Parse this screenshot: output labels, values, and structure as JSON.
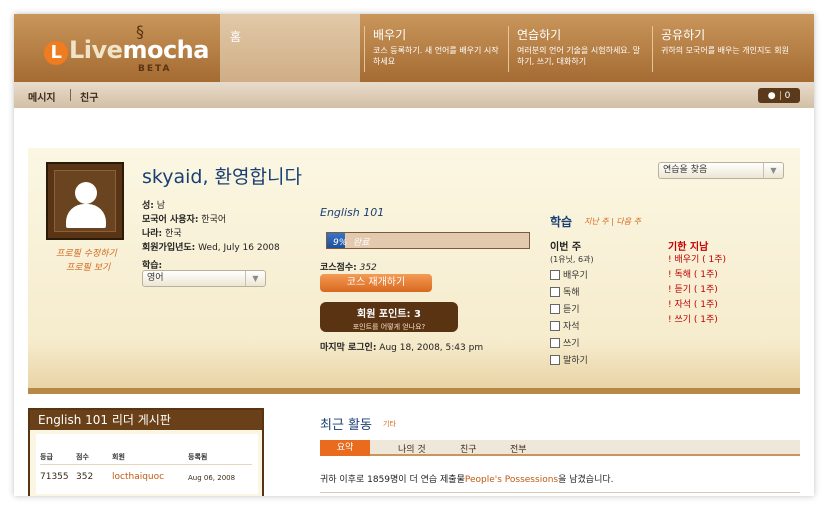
{
  "brand": {
    "logo_live": "Live",
    "logo_mocha": "mocha",
    "logo_beta": "BETA"
  },
  "nav": {
    "home": "홈",
    "learn": {
      "title": "배우기",
      "desc": "코스 등록하기. 새 언어를 배우기 시작하세요"
    },
    "practice": {
      "title": "연습하기",
      "desc": "여러분의 언어 기술을 시험하세요. 말하기, 쓰기, 대화하기"
    },
    "share": {
      "title": "공유하기",
      "desc": "귀하의 모국어를 배우는 개인지도 회원"
    }
  },
  "subnav": {
    "messages": "메시지",
    "friends": "친구",
    "count": "0"
  },
  "profile": {
    "welcome": "skyaid, 환영합니다",
    "edit_link": "프로필 수정하기",
    "view_link": "프로필 보기",
    "gender_label": "성:",
    "gender_value": "남",
    "native_label": "모국어 사용자:",
    "native_value": "한국어",
    "country_label": "나라:",
    "country_value": "한국",
    "joined_label": "회원가입년도:",
    "joined_value": "Wed, July 16 2008",
    "learning_label": "학습:",
    "learning_select": "영어",
    "partner_select": "연습을 찾음"
  },
  "course": {
    "title": "English 101",
    "progress_label": "9%",
    "progress_fraction": 0.09,
    "progress_status": "완료",
    "lessons_label": "코스점수:",
    "lessons_value": "352",
    "resume_button": "코스 재개하기",
    "points_title": "회원 포인트: 3",
    "points_sub": "포인트를 어떻게 얻나요?",
    "lastlogin_label": "마지막 로그인:",
    "lastlogin_value": "Aug 18, 2008, 5:43 pm"
  },
  "study": {
    "title": "학습",
    "sub_links": "지난 주 | 다음 주",
    "week_title": "이번 주",
    "week_sub": "(1유닛, 6과)",
    "tasks": [
      "배우기",
      "독해",
      "듣기",
      "자석",
      "쓰기",
      "말하기"
    ],
    "overdue_title": "기한 지남",
    "overdue": [
      "! 배우기 ( 1주)",
      "! 독해 ( 1주)",
      "! 듣기 ( 1주)",
      "! 자석 ( 1주)",
      "! 쓰기 ( 1주)"
    ]
  },
  "leaderboard": {
    "title": "English 101 리더 게시판",
    "headers": [
      "등급",
      "점수",
      "회원",
      "등록됨"
    ],
    "rows": [
      {
        "rank": "71355",
        "score": "352",
        "user": "locthaiquoc",
        "date": "Aug 06, 2008"
      }
    ]
  },
  "activity": {
    "title": "최근 활동",
    "more": "기타",
    "tabs": [
      "요약",
      "나의 것",
      "친구",
      "전부"
    ],
    "line_prefix": "귀하 이후로 1859명이 더 연습 제출물",
    "line_link": "People's Possessions",
    "line_suffix": "을 남겼습니다."
  },
  "colors": {
    "accent": "#e86b1e",
    "brown": "#5a3312",
    "link_blue": "#1a3f74",
    "overdue_red": "#c00000"
  },
  "icons": {
    "counter": "user-icon",
    "dropdown": "chevron-down-icon"
  }
}
